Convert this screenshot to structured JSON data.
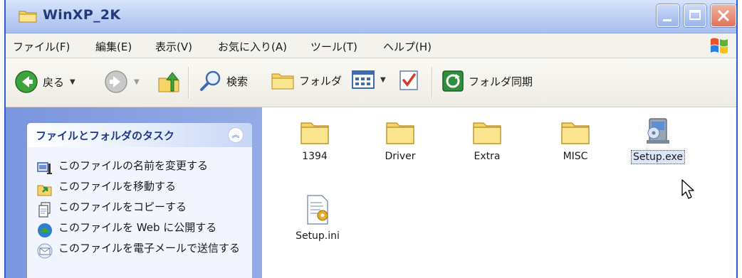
{
  "window": {
    "title": "WinXP_2K"
  },
  "menu": {
    "items": [
      "ファイル(F)",
      "編集(E)",
      "表示(V)",
      "お気に入り(A)",
      "ツール(T)",
      "ヘルプ(H)"
    ]
  },
  "toolbar": {
    "back_label": "戻る",
    "search_label": "検索",
    "folders_label": "フォルダ",
    "sync_label": "フォルダ同期"
  },
  "taskpane": {
    "title": "ファイルとフォルダのタスク",
    "tasks": [
      "このファイルの名前を変更する",
      "このファイルを移動する",
      "このファイルをコピーする",
      "このファイルを Web に公開する",
      "このファイルを電子メールで送信する"
    ]
  },
  "files": [
    {
      "name": "1394",
      "type": "folder"
    },
    {
      "name": "Driver",
      "type": "folder"
    },
    {
      "name": "Extra",
      "type": "folder"
    },
    {
      "name": "MISC",
      "type": "folder"
    },
    {
      "name": "Setup.exe",
      "type": "setup-exe",
      "selected": true
    },
    {
      "name": "Setup.ini",
      "type": "ini-settings"
    }
  ],
  "colors": {
    "title_text": "#223a7a",
    "taskpane_bg": "#7a96df",
    "taskhead_text": "#1f3a8a",
    "folder_yellow": "#f7d96a"
  }
}
